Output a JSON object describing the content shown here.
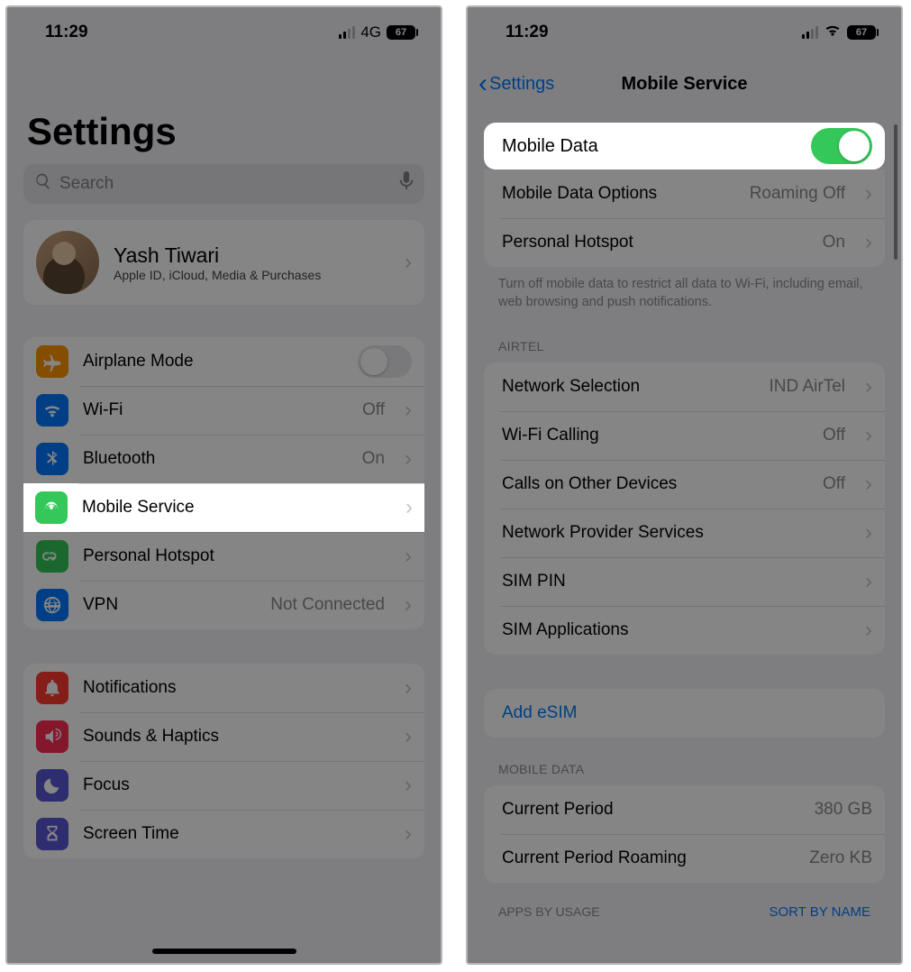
{
  "status": {
    "time": "11:29",
    "network_label": "4G",
    "battery": "67"
  },
  "left": {
    "title": "Settings",
    "search_placeholder": "Search",
    "profile": {
      "name": "Yash Tiwari",
      "subtitle": "Apple ID, iCloud, Media & Purchases"
    },
    "group1": {
      "airplane": "Airplane Mode",
      "wifi": {
        "label": "Wi-Fi",
        "value": "Off"
      },
      "bluetooth": {
        "label": "Bluetooth",
        "value": "On"
      },
      "mobile": "Mobile Service",
      "hotspot": "Personal Hotspot",
      "vpn": {
        "label": "VPN",
        "value": "Not Connected"
      }
    },
    "group2": {
      "notifications": "Notifications",
      "sounds": "Sounds & Haptics",
      "focus": "Focus",
      "screentime": "Screen Time"
    },
    "colors": {
      "airplane": "#ff9500",
      "wifi": "#007aff",
      "bluetooth": "#007aff",
      "mobile": "#34c759",
      "hotspot": "#34c759",
      "vpn": "#007aff",
      "notifications": "#ff3b30",
      "sounds": "#ff2d55",
      "focus": "#5856d6",
      "screentime": "#5856d6"
    }
  },
  "right": {
    "back": "Settings",
    "title": "Mobile Service",
    "mobile_data": "Mobile Data",
    "options": {
      "label": "Mobile Data Options",
      "value": "Roaming Off"
    },
    "hotspot": {
      "label": "Personal Hotspot",
      "value": "On"
    },
    "note": "Turn off mobile data to restrict all data to Wi-Fi, including email, web browsing and push notifications.",
    "carrier_header": "AIRTEL",
    "network_selection": {
      "label": "Network Selection",
      "value": "IND AirTel"
    },
    "wifi_calling": {
      "label": "Wi-Fi Calling",
      "value": "Off"
    },
    "calls_other": {
      "label": "Calls on Other Devices",
      "value": "Off"
    },
    "provider_services": "Network Provider Services",
    "sim_pin": "SIM PIN",
    "sim_apps": "SIM Applications",
    "add_esim": "Add eSIM",
    "md_header": "MOBILE DATA",
    "current_period": {
      "label": "Current Period",
      "value": "380 GB"
    },
    "roaming": {
      "label": "Current Period Roaming",
      "value": "Zero KB"
    },
    "apps_header": "APPS BY USAGE",
    "sort": "SORT BY NAME"
  }
}
